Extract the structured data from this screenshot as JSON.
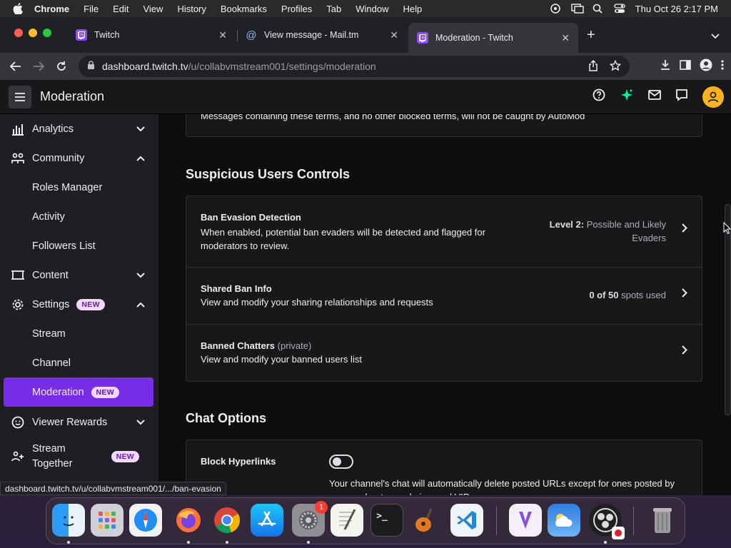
{
  "menubar": {
    "app": "Chrome",
    "items": [
      "File",
      "Edit",
      "View",
      "History",
      "Bookmarks",
      "Profiles",
      "Tab",
      "Window",
      "Help"
    ],
    "clock": "Thu Oct 26  2:17 PM"
  },
  "tabs": [
    {
      "title": "Twitch"
    },
    {
      "title": "View message - Mail.tm"
    },
    {
      "title": "Moderation - Twitch"
    }
  ],
  "omnibox": {
    "host": "dashboard.twitch.tv",
    "path": "/u/collabvmstream001/settings/moderation"
  },
  "topnav": {
    "title": "Moderation"
  },
  "sidebar": {
    "items": [
      {
        "label": "Analytics",
        "icon": "analytics-icon"
      },
      {
        "label": "Community",
        "icon": "community-icon"
      },
      {
        "label": "Roles Manager"
      },
      {
        "label": "Activity"
      },
      {
        "label": "Followers List"
      },
      {
        "label": "Content",
        "icon": "content-icon"
      },
      {
        "label": "Settings",
        "icon": "gear-icon",
        "badge": "NEW"
      },
      {
        "label": "Stream"
      },
      {
        "label": "Channel"
      },
      {
        "label": "Moderation",
        "badge": "NEW"
      },
      {
        "label": "Viewer Rewards",
        "icon": "rewards-icon"
      },
      {
        "label": "Stream Together",
        "icon": "stream-together-icon",
        "badge": "NEW"
      }
    ]
  },
  "main": {
    "automod_note": "Messages containing these terms, and no other blocked terms, will not be caught by AutoMod",
    "suspicious": {
      "title": "Suspicious Users Controls",
      "rows": [
        {
          "title": "Ban Evasion Detection",
          "desc": "When enabled, potential ban evaders will be detected and flagged for moderators to review.",
          "value_bold": "Level 2:",
          "value": " Possible and Likely Evaders"
        },
        {
          "title": "Shared Ban Info",
          "desc": "View and modify your sharing relationships and requests",
          "value_bold": "0 of 50",
          "value": " spots used"
        },
        {
          "title": "Banned Chatters",
          "title_suffix": "(private)",
          "desc": "View and modify your banned users list"
        }
      ]
    },
    "chat_options": {
      "title": "Chat Options",
      "block_hyperlinks": {
        "title": "Block Hyperlinks",
        "enabled": false,
        "desc": "Your channel's chat will automatically delete posted URLs except for ones posted by you, moderators, admins, and VIPs."
      }
    }
  },
  "statusbar": {
    "url": "dashboard.twitch.tv/u/collabvmstream001/.../ban-evasion"
  },
  "dock": {
    "settings_badge": "1"
  },
  "colors": {
    "twitch_purple": "#772ce8",
    "badge_bg": "#f2d7ff",
    "page_bg": "#0e0e10",
    "panel_bg": "#18181b"
  }
}
